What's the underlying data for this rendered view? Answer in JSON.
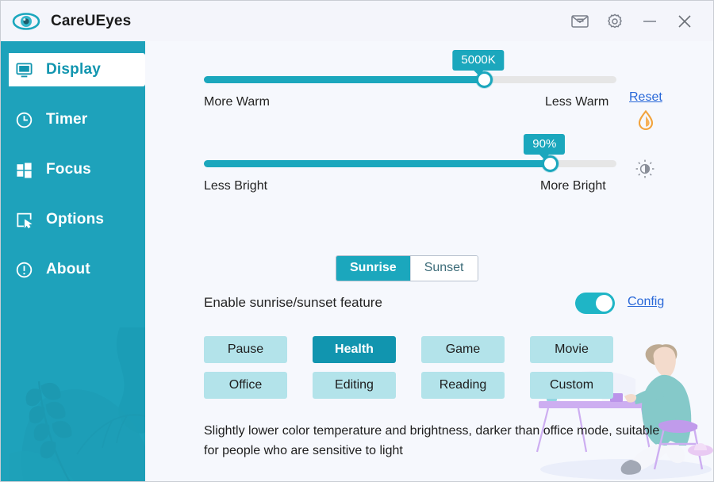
{
  "window": {
    "app_title": "CareUEyes",
    "logo_icon": "eye-icon",
    "buttons": [
      {
        "name": "feedback-mail-button",
        "icon": "mail-icon"
      },
      {
        "name": "settings-button",
        "icon": "gear-icon"
      },
      {
        "name": "minimize-button",
        "icon": "minimize-icon"
      },
      {
        "name": "close-button",
        "icon": "close-icon"
      }
    ]
  },
  "sidebar": {
    "accent": "#1ea2bb",
    "active_text_color": "#1195af",
    "items": [
      {
        "label": "Display",
        "icon": "monitor-icon",
        "active": true
      },
      {
        "label": "Timer",
        "icon": "clock-icon",
        "active": false
      },
      {
        "label": "Focus",
        "icon": "windows-grid-icon",
        "active": false
      },
      {
        "label": "Options",
        "icon": "cursor-square-icon",
        "active": false
      },
      {
        "label": "About",
        "icon": "info-circle-icon",
        "active": false
      }
    ]
  },
  "main": {
    "temperature_slider": {
      "value_label": "5000K",
      "percent": 68,
      "left_label": "More Warm",
      "right_label": "Less Warm",
      "reset_label": "Reset",
      "side_icon": "droplet-icon",
      "side_icon_color": "#f2a33c"
    },
    "brightness_slider": {
      "value_label": "90%",
      "percent": 84,
      "left_label": "Less Bright",
      "right_label": "More Bright",
      "side_icon": "brightness-icon",
      "side_icon_color": "#8a8f99"
    },
    "segmented": {
      "options": [
        "Sunrise",
        "Sunset"
      ],
      "selected": "Sunrise"
    },
    "enable_row": {
      "label": "Enable sunrise/sunset feature",
      "toggle_on": true,
      "config_label": "Config"
    },
    "modes": [
      {
        "label": "Pause",
        "active": false
      },
      {
        "label": "Health",
        "active": true
      },
      {
        "label": "Game",
        "active": false
      },
      {
        "label": "Movie",
        "active": false
      },
      {
        "label": "Office",
        "active": false
      },
      {
        "label": "Editing",
        "active": false
      },
      {
        "label": "Reading",
        "active": false
      },
      {
        "label": "Custom",
        "active": false
      }
    ],
    "description": "Slightly lower color temperature and brightness, darker than office mode, suitable for people who are sensitive to light",
    "illustration": "person-at-desk-illustration"
  },
  "theme": {
    "accent": "#1ba7bd",
    "accent_dark": "#1195af",
    "mode_button_bg": "#b3e3ea",
    "link_color": "#2968d8",
    "panel_bg": "#f6f8fd"
  }
}
